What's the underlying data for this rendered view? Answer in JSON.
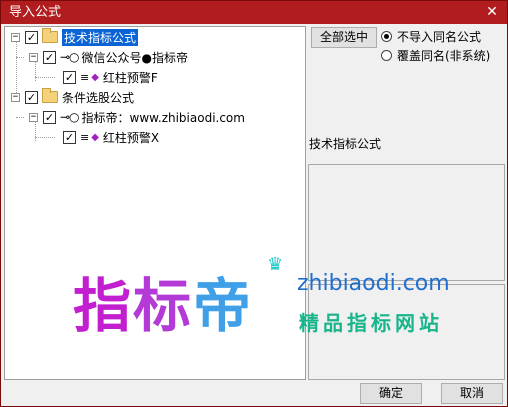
{
  "window": {
    "title": "导入公式",
    "close_glyph": "✕"
  },
  "tree": {
    "groups": [
      {
        "label": "技术指标公式",
        "expander": "−",
        "checked": true,
        "selected": true,
        "source": {
          "label": "微信公众号●指标帝",
          "expander": "−",
          "checked": true
        },
        "items": [
          {
            "label": "红柱预警F",
            "checked": true
          }
        ]
      },
      {
        "label": "条件选股公式",
        "expander": "−",
        "checked": true,
        "selected": false,
        "source": {
          "label": "指标帝：www.zhibiaodi.com",
          "expander": "−",
          "checked": true
        },
        "items": [
          {
            "label": "红柱预警X",
            "checked": true
          }
        ]
      }
    ],
    "check_glyph": "✓"
  },
  "options": {
    "select_all_label": "全部选中",
    "radio_skip_label": "不导入同名公式",
    "radio_overwrite_label": "覆盖同名(非系统)",
    "selected_radio": "skip"
  },
  "description": {
    "label": "技术指标公式"
  },
  "footer": {
    "ok_label": "确定",
    "cancel_label": "取消"
  },
  "watermark": {
    "chars": [
      "指",
      "标",
      "帝"
    ],
    "url": "zhibiaodi.com",
    "tagline": "精品指标网站"
  },
  "colors": {
    "titlebar": "#b11d1f",
    "selection": "#0a64d6",
    "diamond_icon": "#a020c0"
  }
}
